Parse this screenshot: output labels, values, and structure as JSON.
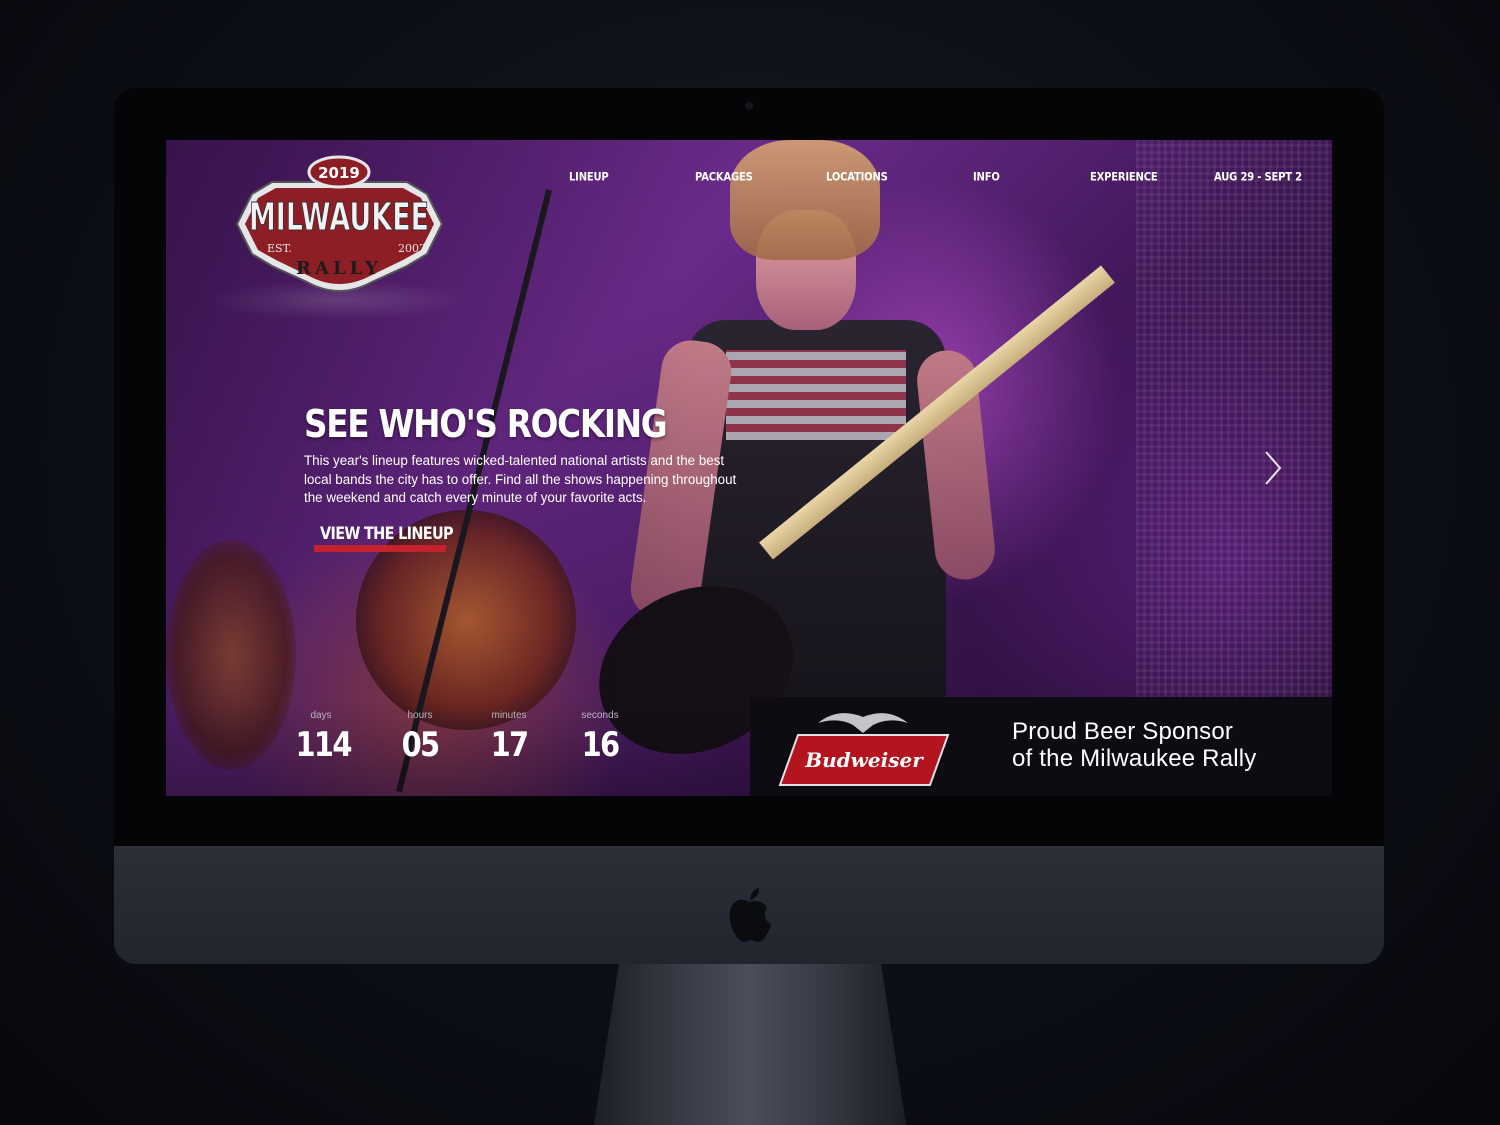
{
  "logo": {
    "year": "2019",
    "name": "MILWAUKEE",
    "sub": "RALLY",
    "est_left": "EST.",
    "est_right": "2002"
  },
  "nav": {
    "items": [
      "LINEUP",
      "PACKAGES",
      "LOCATIONS",
      "INFO",
      "EXPERIENCE"
    ],
    "dates": "AUG 29 - SEPT 2"
  },
  "hero": {
    "title": "SEE WHO'S ROCKING",
    "description": "This year's lineup features wicked-talented national artists and the best local bands the city has to offer. Find all the shows happening throughout the weekend and catch every minute of your favorite acts.",
    "cta": "VIEW THE LINEUP",
    "next_icon": "chevron-right-icon"
  },
  "countdown": {
    "days": {
      "label": "days",
      "value": "114"
    },
    "hours": {
      "label": "hours",
      "value": "05"
    },
    "minutes": {
      "label": "minutes",
      "value": "17"
    },
    "seconds": {
      "label": "seconds",
      "value": "16"
    }
  },
  "sponsor": {
    "brand": "Budweiser",
    "line1": "Proud Beer Sponsor",
    "line2": "of the Milwaukee Rally"
  },
  "colors": {
    "accent_red": "#c4222e",
    "hero_purple": "#6a2a8a",
    "sponsor_bg": "#0e0c12"
  },
  "device": {
    "brand_icon": "apple-logo-icon"
  }
}
